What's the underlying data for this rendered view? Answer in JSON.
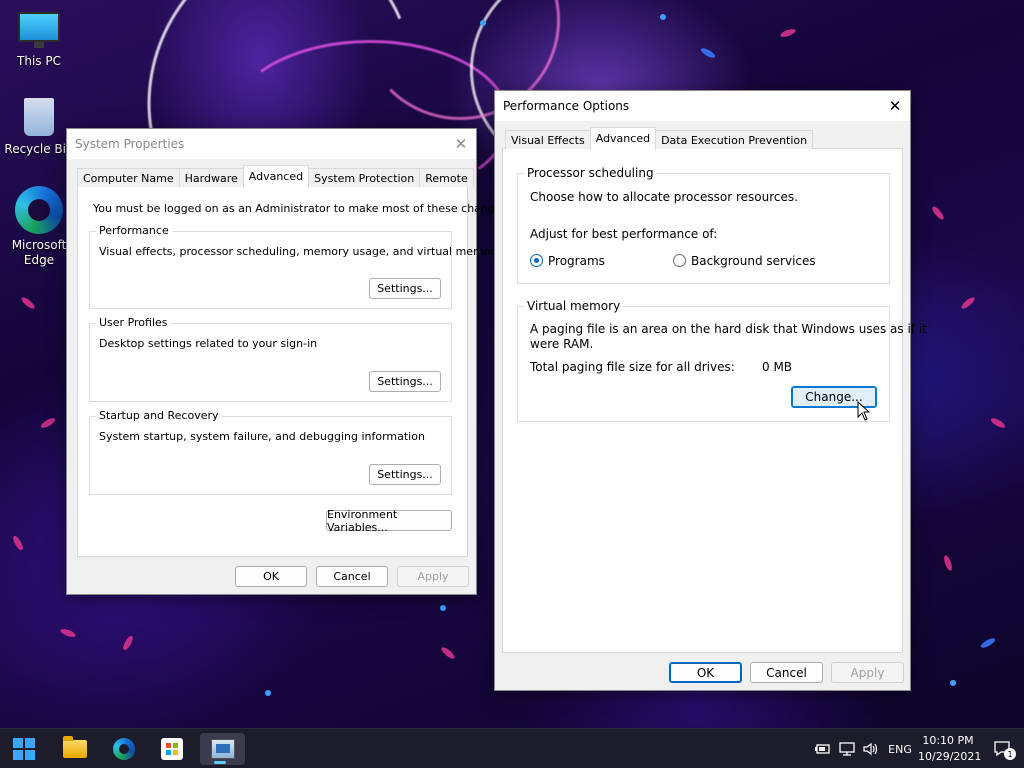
{
  "desktop": {
    "icons": [
      {
        "label": "This PC",
        "icon": "monitor-icon"
      },
      {
        "label": "Recycle Bin",
        "icon": "recycle-bin-icon"
      },
      {
        "label": "Microsoft Edge",
        "icon": "edge-icon"
      }
    ]
  },
  "system_properties": {
    "title": "System Properties",
    "tabs": [
      "Computer Name",
      "Hardware",
      "Advanced",
      "System Protection",
      "Remote"
    ],
    "active_tab": "Advanced",
    "admin_note": "You must be logged on as an Administrator to make most of these changes.",
    "performance": {
      "title": "Performance",
      "description": "Visual effects, processor scheduling, memory usage, and virtual memory",
      "button": "Settings..."
    },
    "user_profiles": {
      "title": "User Profiles",
      "description": "Desktop settings related to your sign-in",
      "button": "Settings..."
    },
    "startup_recovery": {
      "title": "Startup and Recovery",
      "description": "System startup, system failure, and debugging information",
      "button": "Settings..."
    },
    "env_button": "Environment Variables...",
    "ok": "OK",
    "cancel": "Cancel",
    "apply": "Apply"
  },
  "performance_options": {
    "title": "Performance Options",
    "tabs": [
      "Visual Effects",
      "Advanced",
      "Data Execution Prevention"
    ],
    "active_tab": "Advanced",
    "processor_scheduling": {
      "title": "Processor scheduling",
      "description": "Choose how to allocate processor resources.",
      "adjust_label": "Adjust for best performance of:",
      "options": [
        {
          "label": "Programs",
          "selected": true
        },
        {
          "label": "Background services",
          "selected": false
        }
      ]
    },
    "virtual_memory": {
      "title": "Virtual memory",
      "description_line1": "A paging file is an area on the hard disk that Windows uses as if it",
      "description_line2": "were RAM.",
      "total_label": "Total paging file size for all drives:",
      "total_value": "0 MB",
      "change_button": "Change..."
    },
    "ok": "OK",
    "cancel": "Cancel",
    "apply": "Apply"
  },
  "taskbar": {
    "apps": [
      "start-icon",
      "file-explorer-icon",
      "edge-icon",
      "store-icon",
      "system-properties-icon"
    ],
    "language": "ENG",
    "time": "10:10 PM",
    "date": "10/29/2021",
    "notification_count": "1"
  }
}
